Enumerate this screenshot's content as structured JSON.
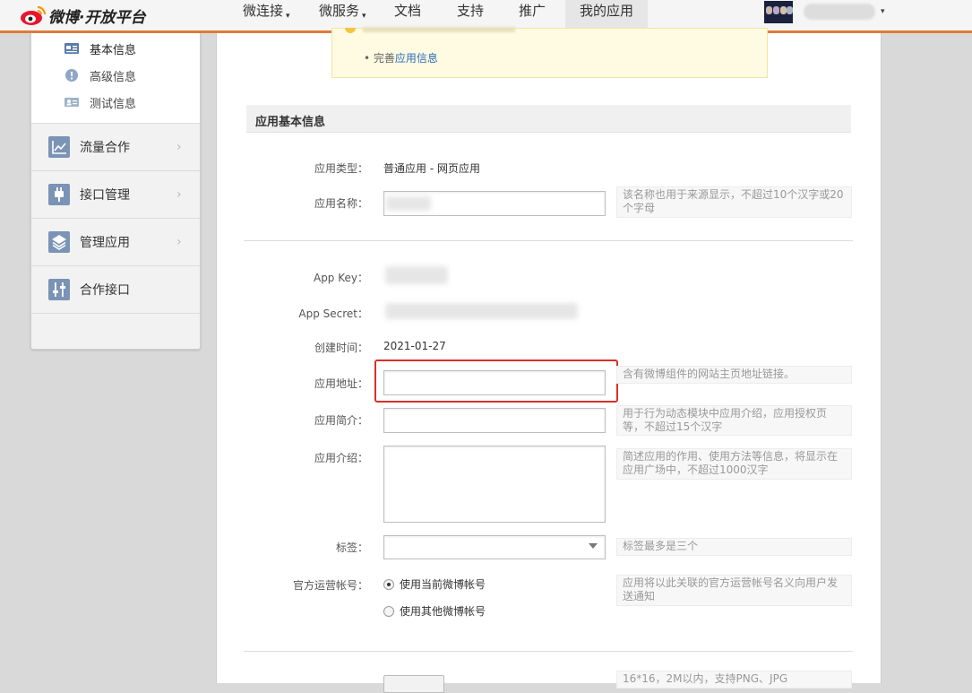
{
  "brand": {
    "logo_text": "微博·开放平台"
  },
  "nav": {
    "items": [
      {
        "label": "微连接",
        "caret": "▾"
      },
      {
        "label": "微服务",
        "caret": "▾"
      },
      {
        "label": "文档"
      },
      {
        "label": "支持"
      },
      {
        "label": "推广"
      },
      {
        "label": "我的应用",
        "active": true
      }
    ]
  },
  "user": {
    "caret": "▾"
  },
  "sidebar": {
    "sub_items": [
      {
        "label": "基本信息",
        "icon": "id-card-icon",
        "active": true
      },
      {
        "label": "高级信息",
        "icon": "info-icon"
      },
      {
        "label": "测试信息",
        "icon": "user-card-icon"
      }
    ],
    "menu": [
      {
        "label": "流量合作",
        "icon": "line-chart-icon",
        "chevron": "›"
      },
      {
        "label": "接口管理",
        "icon": "plug-icon",
        "chevron": "›"
      },
      {
        "label": "管理应用",
        "icon": "layers-icon",
        "chevron": "›"
      },
      {
        "label": "合作接口",
        "icon": "sliders-icon"
      }
    ]
  },
  "notice": {
    "bullet": "• 完善",
    "link": "应用信息"
  },
  "section": {
    "title": "应用基本信息"
  },
  "form": {
    "type_label": "应用类型：",
    "type_value": "普通应用  -  网页应用",
    "name_label": "应用名称：",
    "name_hint": "该名称也用于来源显示，不超过10个汉字或20个字母",
    "appkey_label": "App Key：",
    "secret_label": "App Secret：",
    "created_label": "创建时间：",
    "created_value": "2021-01-27",
    "url_label": "应用地址：",
    "url_hint": "含有微博组件的网站主页地址链接。",
    "brief_label": "应用简介：",
    "brief_hint": "用于行为动态模块中应用介绍，应用授权页等，不超过15个汉字",
    "intro_label": "应用介绍：",
    "intro_hint": "简述应用的作用、使用方法等信息，将显示在应用广场中，不超过1000汉字",
    "tags_label": "标签：",
    "tags_hint": "标签最多是三个",
    "account_label": "官方运营帐号：",
    "account_hint": "应用将以此关联的官方运营帐号名义向用户发送通知",
    "radio_current": "使用当前微博帐号",
    "radio_other": "使用其他微博帐号",
    "icon_hint": "16*16，2M以内，支持PNG、JPG"
  },
  "colors": {
    "accent": "#e07b38",
    "highlight": "#d9302a",
    "link": "#2a6eb8"
  }
}
